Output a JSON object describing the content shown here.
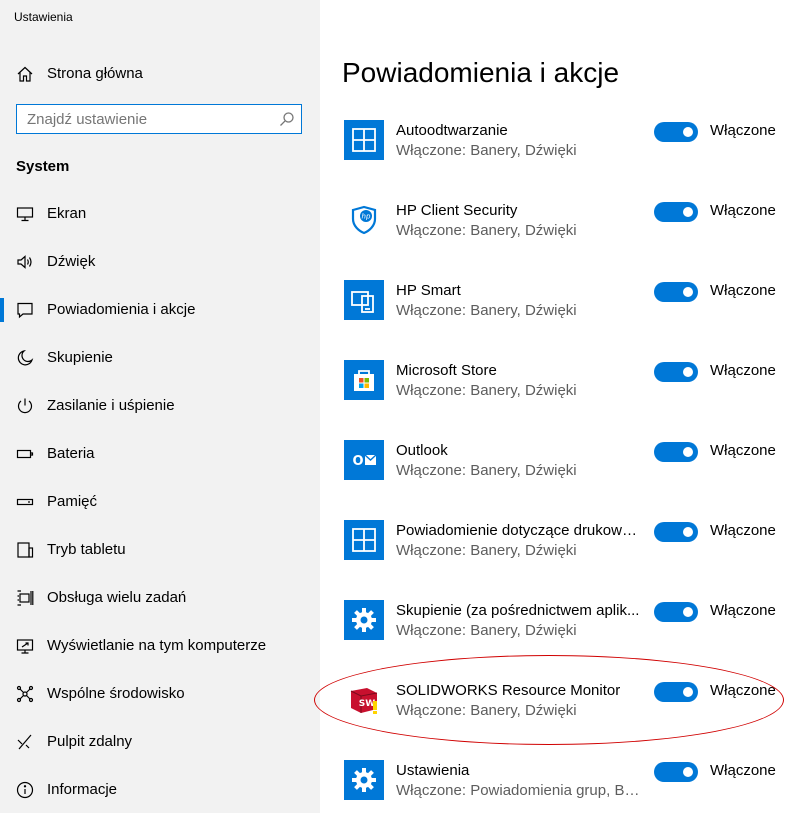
{
  "window": {
    "title": "Ustawienia"
  },
  "sidebar": {
    "home_label": "Strona główna",
    "search": {
      "placeholder": "Znajdź ustawienie"
    },
    "section_title": "System",
    "items": [
      {
        "label": "Ekran",
        "icon": "display-icon"
      },
      {
        "label": "Dźwięk",
        "icon": "speaker-icon"
      },
      {
        "label": "Powiadomienia i akcje",
        "icon": "notification-icon",
        "selected": true
      },
      {
        "label": "Skupienie",
        "icon": "moon-icon"
      },
      {
        "label": "Zasilanie i uśpienie",
        "icon": "power-icon"
      },
      {
        "label": "Bateria",
        "icon": "battery-icon"
      },
      {
        "label": "Pamięć",
        "icon": "storage-icon"
      },
      {
        "label": "Tryb tabletu",
        "icon": "tablet-icon"
      },
      {
        "label": "Obsługa wielu zadań",
        "icon": "multitask-icon"
      },
      {
        "label": "Wyświetlanie na tym komputerze",
        "icon": "project-icon"
      },
      {
        "label": "Wspólne środowisko",
        "icon": "share-icon"
      },
      {
        "label": "Pulpit zdalny",
        "icon": "remote-icon"
      },
      {
        "label": "Informacje",
        "icon": "info-icon"
      }
    ]
  },
  "main": {
    "title": "Powiadomienia i akcje",
    "apps": [
      {
        "name": "Autoodtwarzanie",
        "sub": "Włączone: Banery, Dźwięki",
        "toggle": "Włączone",
        "icon": "autoplay-icon"
      },
      {
        "name": "HP Client Security",
        "sub": "Włączone: Banery, Dźwięki",
        "toggle": "Włączone",
        "icon": "hp-shield-icon"
      },
      {
        "name": "HP Smart",
        "sub": "Włączone: Banery, Dźwięki",
        "toggle": "Włączone",
        "icon": "hp-smart-icon"
      },
      {
        "name": "Microsoft Store",
        "sub": "Włączone: Banery, Dźwięki",
        "toggle": "Włączone",
        "icon": "store-bag-icon"
      },
      {
        "name": "Outlook",
        "sub": "Włączone: Banery, Dźwięki",
        "toggle": "Włączone",
        "icon": "outlook-icon"
      },
      {
        "name": "Powiadomienie dotyczące drukowa...",
        "sub": "Włączone: Banery, Dźwięki",
        "toggle": "Włączone",
        "icon": "print-notify-icon"
      },
      {
        "name": "Skupienie (za pośrednictwem aplik...",
        "sub": "Włączone: Banery, Dźwięki",
        "toggle": "Włączone",
        "icon": "gear-icon"
      },
      {
        "name": "SOLIDWORKS Resource Monitor",
        "sub": "Włączone: Banery, Dźwięki",
        "toggle": "Włączone",
        "icon": "solidworks-icon"
      },
      {
        "name": "Ustawienia",
        "sub": "Włączone: Powiadomienia grup, Ba...",
        "toggle": "Włączone",
        "icon": "gear-icon"
      }
    ]
  },
  "colors": {
    "accent": "#0078d7",
    "annotation": "#d00000",
    "sidebar_bg": "#f2f2f2"
  }
}
